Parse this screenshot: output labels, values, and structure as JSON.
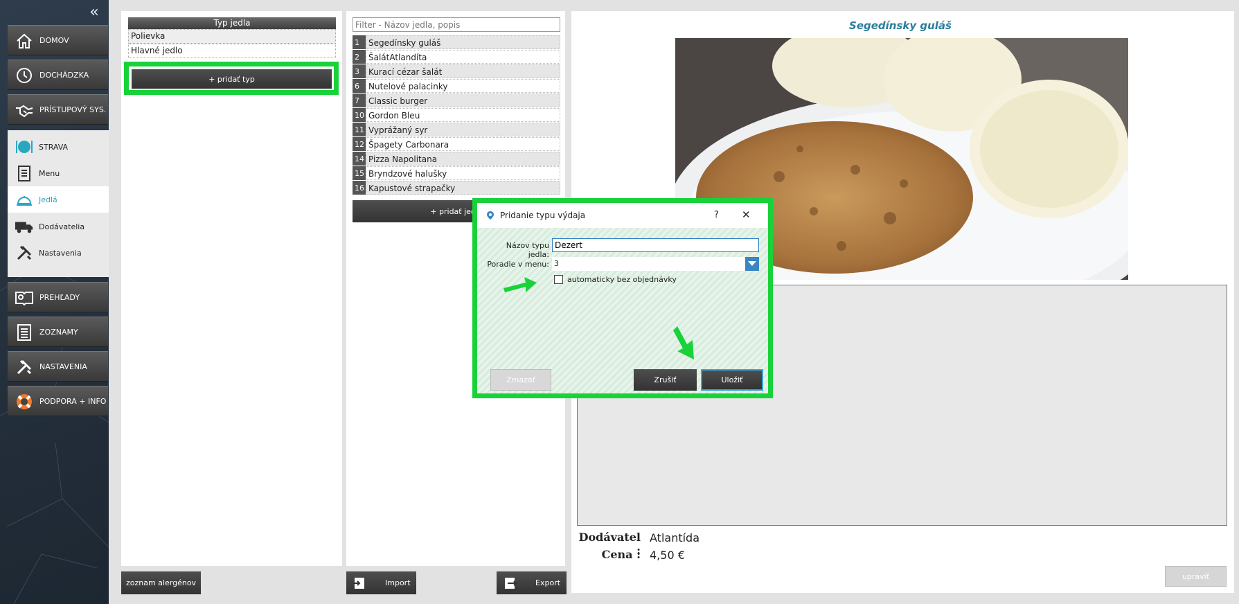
{
  "sidebar": {
    "collapse_icon": "chevron-double-left-icon",
    "nav": [
      {
        "label": "DOMOV",
        "icon": "home-icon"
      },
      {
        "label": "DOCHÁDZKA",
        "icon": "clock-icon"
      },
      {
        "label": "PRÍSTUPOVÝ SYS.",
        "icon": "handshake-icon"
      },
      {
        "label": "PREHĽADY",
        "icon": "book-search-icon"
      },
      {
        "label": "ZOZNAMY",
        "icon": "list-icon"
      },
      {
        "label": "NASTAVENIA",
        "icon": "tools-icon"
      },
      {
        "label": "PODPORA + INFO",
        "icon": "lifebuoy-icon"
      }
    ],
    "strava": {
      "label": "STRAVA",
      "items": [
        {
          "label": "Menu",
          "icon": "clipboard-icon"
        },
        {
          "label": "Jedlá",
          "icon": "cloche-icon",
          "active": true
        },
        {
          "label": "Dodávatelia",
          "icon": "truck-icon"
        },
        {
          "label": "Nastavenia",
          "icon": "tools-icon"
        }
      ]
    }
  },
  "types_panel": {
    "header": "Typ jedla",
    "rows": [
      "Polievka",
      "Hlavné jedlo"
    ],
    "add_button": "+ pridať typ",
    "allergens_button": "zoznam alergénov"
  },
  "foods_panel": {
    "filter_placeholder": "Filter - Názov jedla, popis",
    "rows": [
      {
        "num": "1",
        "name": "Segedínsky guláš"
      },
      {
        "num": "2",
        "name": "ŠalátAtlandíta"
      },
      {
        "num": "3",
        "name": "Kurací cézar šalát"
      },
      {
        "num": "6",
        "name": "Nutelové palacinky"
      },
      {
        "num": "7",
        "name": "Classic burger"
      },
      {
        "num": "10",
        "name": "Gordon Bleu"
      },
      {
        "num": "11",
        "name": "Vyprážaný syr"
      },
      {
        "num": "12",
        "name": "Špagety Carbonara"
      },
      {
        "num": "14",
        "name": "Pizza Napolitana"
      },
      {
        "num": "15",
        "name": "Bryndzové halušky"
      },
      {
        "num": "16",
        "name": "Kapustové strapačky"
      }
    ],
    "add_button": "+ pridať jedlo",
    "import_button": "Import",
    "export_button": "Export"
  },
  "detail": {
    "title": "Segedínsky guláš",
    "supplier_label": "Dodávatel :",
    "supplier_value": "Atlantída",
    "price_label": "Cena :",
    "price_value": "4,50 €",
    "edit_button": "upraviť"
  },
  "dialog": {
    "title": "Pridanie typu výdaja",
    "help": "?",
    "close": "✕",
    "name_label": "Názov typu jedla:",
    "name_value": "Dezert",
    "order_label": "Poradie v menu:",
    "order_value": "3",
    "checkbox_label": "automaticky bez objednávky",
    "checkbox_checked": false,
    "delete_button": "Zmazať",
    "cancel_button": "Zrušiť",
    "save_button": "Uložiť"
  },
  "colors": {
    "highlight": "#19d23a",
    "accent": "#2aa7c0",
    "title": "#2a7d9c"
  }
}
